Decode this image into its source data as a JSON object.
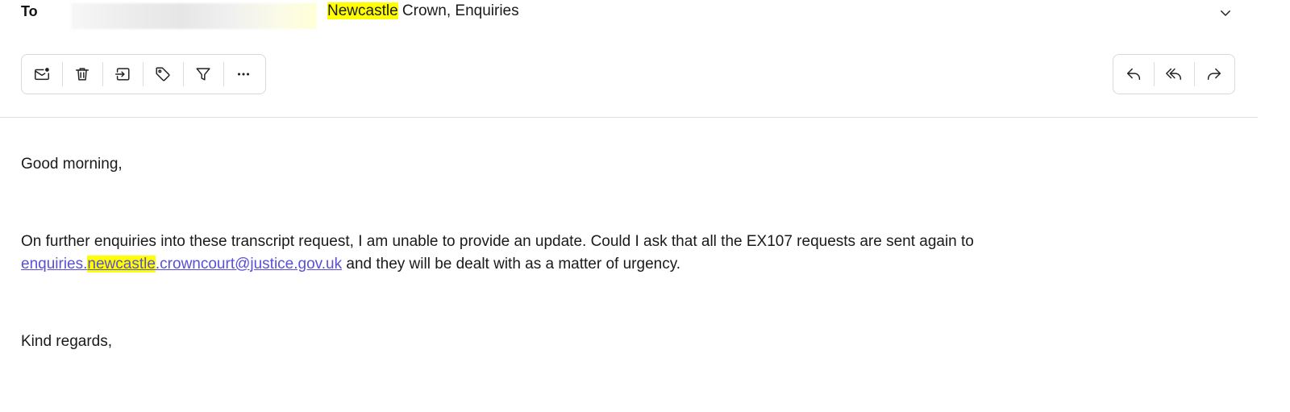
{
  "header": {
    "to_label": "To",
    "to_highlight": "Newcastle",
    "to_rest": " Crown, Enquiries"
  },
  "toolbar": {
    "left_buttons": [
      {
        "name": "mark-unread",
        "icon": "envelope-dot-icon"
      },
      {
        "name": "delete",
        "icon": "trash-icon"
      },
      {
        "name": "move",
        "icon": "move-to-folder-icon"
      },
      {
        "name": "tag",
        "icon": "tag-icon"
      },
      {
        "name": "filter",
        "icon": "filter-icon"
      },
      {
        "name": "more",
        "icon": "more-horizontal-icon"
      }
    ],
    "right_buttons": [
      {
        "name": "reply",
        "icon": "reply-icon"
      },
      {
        "name": "reply-all",
        "icon": "reply-all-icon"
      },
      {
        "name": "forward",
        "icon": "forward-icon"
      }
    ]
  },
  "message": {
    "greeting": "Good morning,",
    "para_line1": "On further enquiries into these transcript request, I am unable to provide an update.  Could I ask that all the EX107 requests are sent again to",
    "email_part1": "enquiries.",
    "email_highlight": "newcastle",
    "email_part2": ".crowncourt@justice.gov.uk",
    "para_line2_rest": " and they will be dealt with as a matter of urgency.",
    "signoff": "Kind regards,"
  },
  "colors": {
    "highlight": "#ffff00",
    "link": "#5b4fd6",
    "border": "#d9d9d9"
  }
}
